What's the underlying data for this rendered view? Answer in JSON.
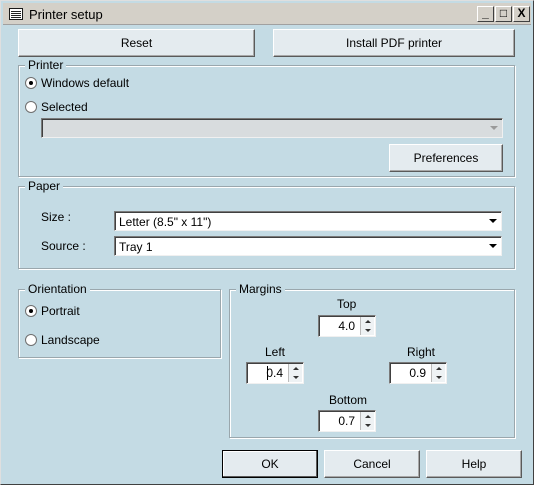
{
  "window": {
    "title": "Printer setup"
  },
  "titlebar": {
    "minimize": "_",
    "maximize": "□",
    "close": "X"
  },
  "top_buttons": {
    "reset": "Reset",
    "install_pdf": "Install PDF printer"
  },
  "printer": {
    "label": "Printer",
    "windows_default": "Windows default",
    "selected": "Selected",
    "selected_value": "",
    "preferences": "Preferences"
  },
  "paper": {
    "label": "Paper",
    "size_label": "Size :",
    "size_value": "Letter (8.5\" x 11\")",
    "source_label": "Source :",
    "source_value": "Tray 1"
  },
  "orientation": {
    "label": "Orientation",
    "portrait": "Portrait",
    "landscape": "Landscape",
    "selected": "Portrait"
  },
  "margins": {
    "label": "Margins",
    "top_label": "Top",
    "top_value": "4.0",
    "left_label": "Left",
    "left_value": "0.4",
    "right_label": "Right",
    "right_value": "0.9",
    "bottom_label": "Bottom",
    "bottom_value": "0.7"
  },
  "footer": {
    "ok": "OK",
    "cancel": "Cancel",
    "help": "Help"
  }
}
